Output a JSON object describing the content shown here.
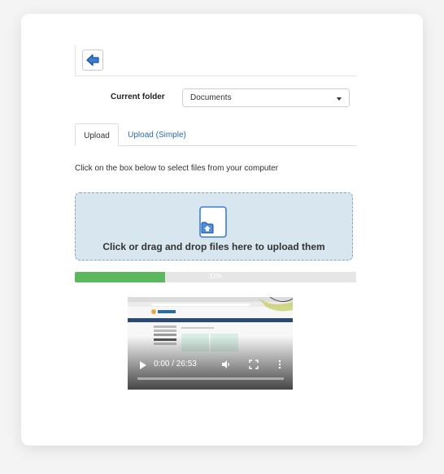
{
  "toolbar": {
    "back_icon": "arrow-left-icon"
  },
  "folder": {
    "label": "Current folder",
    "selected": "Documents"
  },
  "tabs": [
    {
      "label": "Upload",
      "active": true
    },
    {
      "label": "Upload (Simple)",
      "active": false
    }
  ],
  "instructions": "Click on the box below to select files from your computer",
  "dropzone": {
    "icon": "file-upload-icon",
    "text": "Click or drag and drop files here to upload them"
  },
  "progress": {
    "label": "32%",
    "fraction": 0.32
  },
  "video": {
    "time": "0:00 / 26:53",
    "controls": [
      "play-icon",
      "volume-icon",
      "fullscreen-icon",
      "more-options-icon"
    ]
  },
  "colors": {
    "accent_link": "#2d6ca2",
    "progress_fill": "#5cb85c",
    "dropzone_bg": "#d8e6f0",
    "back_arrow": "#3a7fd5"
  }
}
